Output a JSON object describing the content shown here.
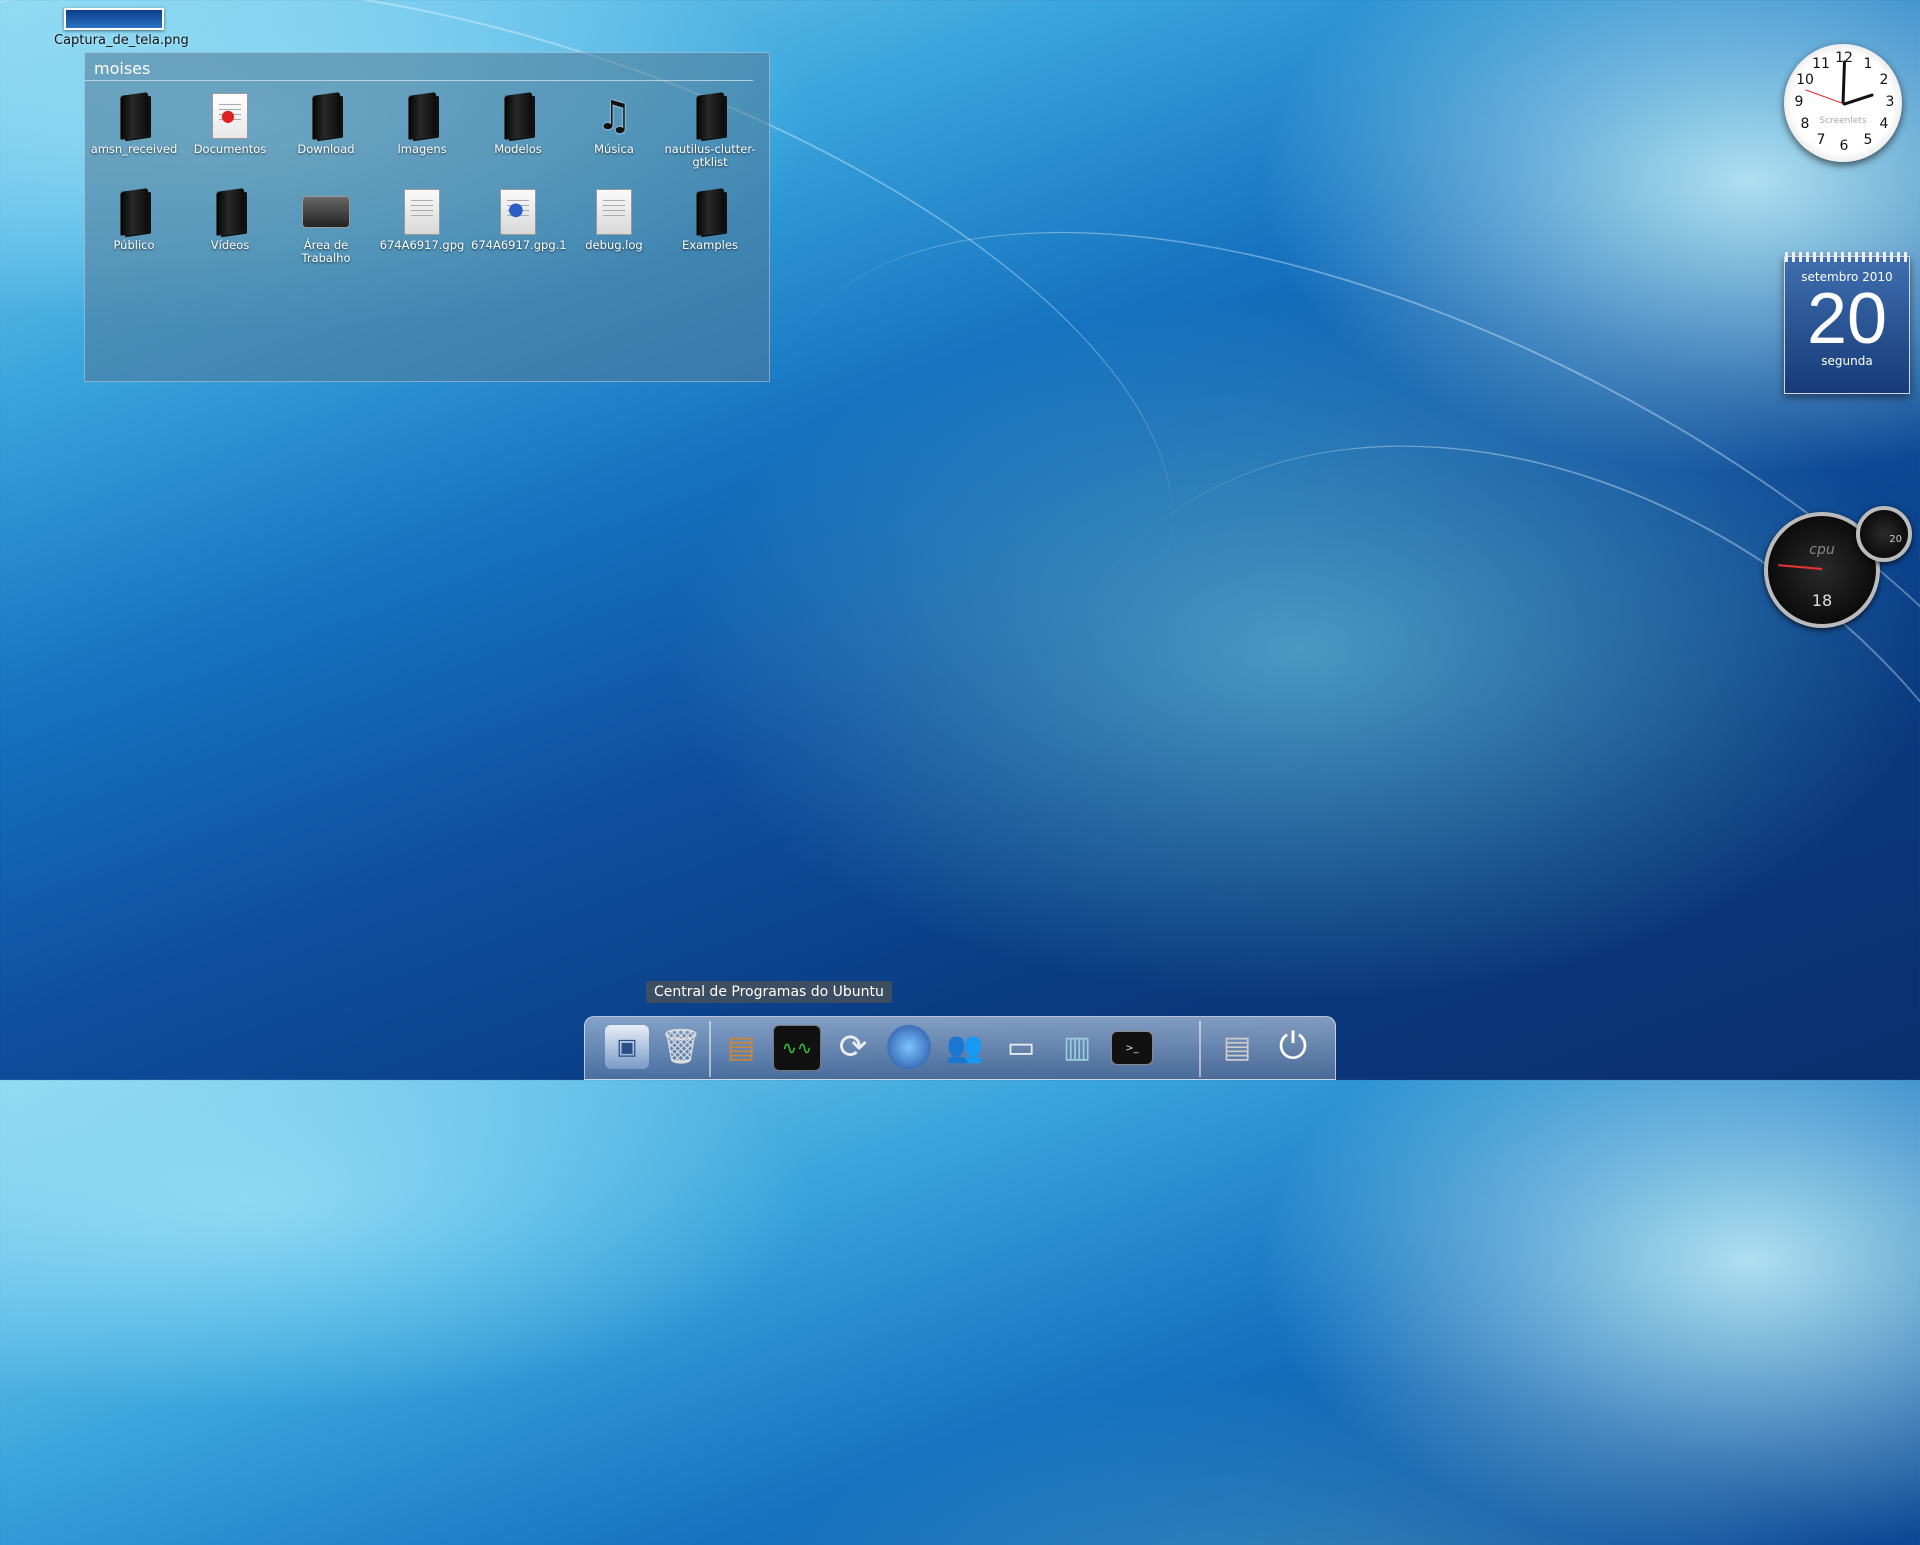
{
  "desktop": {
    "file": {
      "label": "Captura_de_tela.png"
    }
  },
  "folder_view": {
    "title": "moises",
    "items": [
      {
        "label": "amsn_received",
        "icon": "folder-icon"
      },
      {
        "label": "Documentos",
        "icon": "documents-folder-icon"
      },
      {
        "label": "Download",
        "icon": "folder-icon"
      },
      {
        "label": "Imagens",
        "icon": "folder-icon"
      },
      {
        "label": "Modelos",
        "icon": "folder-icon"
      },
      {
        "label": "Música",
        "icon": "music-folder-icon"
      },
      {
        "label": "nautilus-clutter-gtklist",
        "icon": "folder-icon"
      },
      {
        "label": "Público",
        "icon": "folder-icon"
      },
      {
        "label": "Vídeos",
        "icon": "folder-icon"
      },
      {
        "label": "Área de Trabalho",
        "icon": "desktop-folder-icon"
      },
      {
        "label": "674A6917.gpg",
        "icon": "document-icon"
      },
      {
        "label": "674A6917.gpg.1",
        "icon": "document-web-icon"
      },
      {
        "label": "debug.log",
        "icon": "document-icon"
      },
      {
        "label": "Examples",
        "icon": "folder-icon"
      }
    ]
  },
  "widgets": {
    "clock": {
      "brand": "Screenlets",
      "numbers": [
        "12",
        "1",
        "2",
        "3",
        "4",
        "5",
        "6",
        "7",
        "8",
        "9",
        "10",
        "11"
      ]
    },
    "calendar": {
      "month": "setembro 2010",
      "day": "20",
      "weekday": "segunda"
    },
    "cpu": {
      "label": "cpu",
      "value": "18"
    },
    "mem": {
      "value": "20"
    }
  },
  "dock": {
    "tooltip": "Central de Programas do Ubuntu",
    "items": [
      "home-folder-icon",
      "trash-icon",
      "software-center-icon",
      "system-monitor-icon",
      "update-icon",
      "web-browser-icon",
      "messenger-icon",
      "screen-icon",
      "text-editor-icon",
      "terminal-icon",
      "documents-icon",
      "power-icon"
    ]
  },
  "colors": {
    "accent": "#1673c0"
  }
}
